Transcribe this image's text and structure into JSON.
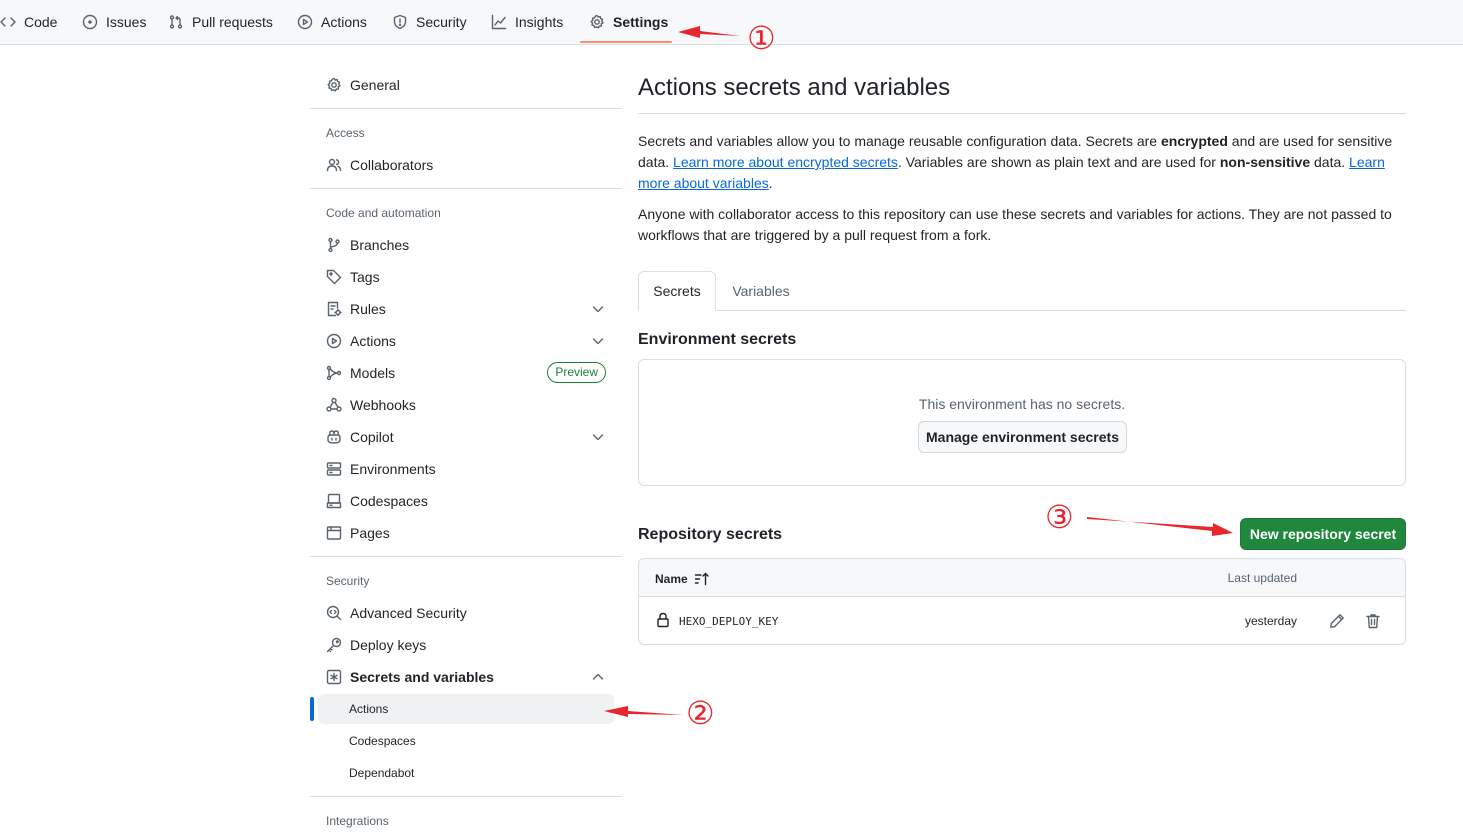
{
  "repo_nav": {
    "items": [
      {
        "label": "Code",
        "icon": "code-icon"
      },
      {
        "label": "Issues",
        "icon": "issue-icon"
      },
      {
        "label": "Pull requests",
        "icon": "pull-request-icon"
      },
      {
        "label": "Actions",
        "icon": "play-icon"
      },
      {
        "label": "Security",
        "icon": "shield-icon"
      },
      {
        "label": "Insights",
        "icon": "graph-icon"
      },
      {
        "label": "Settings",
        "icon": "gear-icon",
        "active": true
      }
    ]
  },
  "sidebar": {
    "general": "General",
    "access_heading": "Access",
    "collaborators": "Collaborators",
    "code_heading": "Code and automation",
    "branches": "Branches",
    "tags": "Tags",
    "rules": "Rules",
    "actions": "Actions",
    "models": "Models",
    "models_badge": "Preview",
    "webhooks": "Webhooks",
    "copilot": "Copilot",
    "environments": "Environments",
    "codespaces": "Codespaces",
    "pages": "Pages",
    "security_heading": "Security",
    "advanced_security": "Advanced Security",
    "deploy_keys": "Deploy keys",
    "secrets_and_variables": "Secrets and variables",
    "sub_actions": "Actions",
    "sub_codespaces": "Codespaces",
    "sub_dependabot": "Dependabot",
    "integrations_heading": "Integrations"
  },
  "main": {
    "title": "Actions secrets and variables",
    "intro": {
      "t1": "Secrets and variables allow you to manage reusable configuration data. Secrets are ",
      "b1": "encrypted",
      "t2": " and are used for sensitive data. ",
      "link1": "Learn more about encrypted secrets",
      "t3": ". Variables are shown as plain text and are used for ",
      "b2": "non-sensitive",
      "t4": " data. ",
      "link2": "Learn more about variables",
      "t5": "."
    },
    "notice": "Anyone with collaborator access to this repository can use these secrets and variables for actions. They are not passed to workflows that are triggered by a pull request from a fork.",
    "tabs": [
      {
        "label": "Secrets",
        "active": true
      },
      {
        "label": "Variables",
        "active": false
      }
    ],
    "env_secrets": {
      "heading": "Environment secrets",
      "empty_text": "This environment has no secrets.",
      "manage_button": "Manage environment secrets"
    },
    "repo_secrets": {
      "heading": "Repository secrets",
      "new_button": "New repository secret",
      "columns": {
        "name": "Name",
        "updated": "Last updated"
      },
      "rows": [
        {
          "name": "HEXO_DEPLOY_KEY",
          "updated": "yesterday"
        }
      ]
    }
  },
  "annotations": {
    "step1": "①",
    "step2": "②",
    "step3": "③",
    "color": "#e8262d"
  },
  "colors": {
    "accent_blue": "#0969da",
    "primary_green": "#1f883d",
    "active_underline": "#fd8c73"
  }
}
